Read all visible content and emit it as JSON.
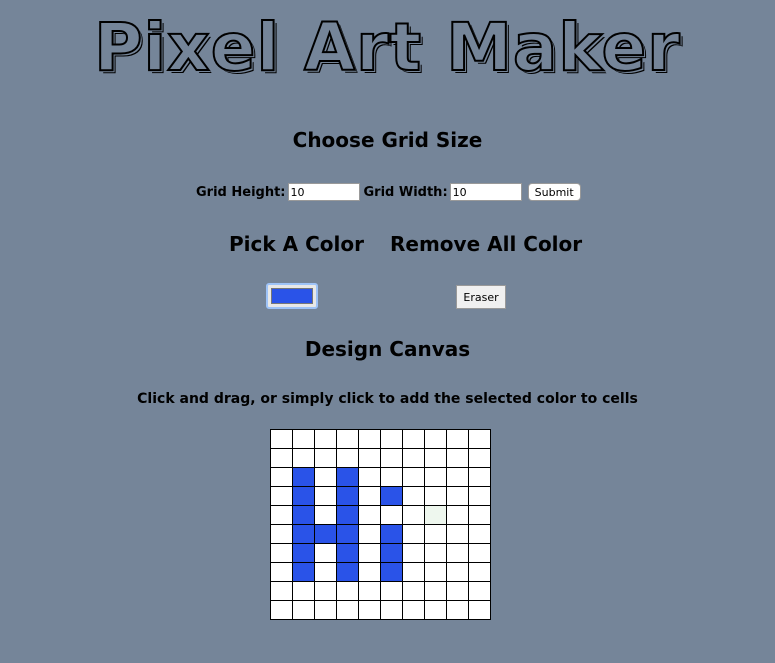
{
  "title": "Pixel Art Maker",
  "grid_size": {
    "heading": "Choose Grid Size",
    "height_label": "Grid Height:",
    "height_value": "10",
    "width_label": "Grid Width:",
    "width_value": "10",
    "submit_label": "Submit"
  },
  "color": {
    "pick_heading": "Pick A Color",
    "remove_heading": "Remove All Color",
    "selected_color": "#2a53e8",
    "eraser_label": "Eraser"
  },
  "canvas": {
    "heading": "Design Canvas",
    "instructions": "Click and drag, or simply click to add the selected color to cells",
    "rows": 10,
    "cols": 10,
    "cell_color_empty": "#ffffff",
    "cell_color_filled": "#2a53e8",
    "cell_color_hover": "#eef7ee",
    "pixels": [
      "..........",
      "..........",
      ".X.X......",
      ".X.X.X....",
      ".X.X...h..",
      ".XXX.X....",
      ".X.X.X....",
      ".X.X.X....",
      "..........",
      ".........."
    ]
  }
}
